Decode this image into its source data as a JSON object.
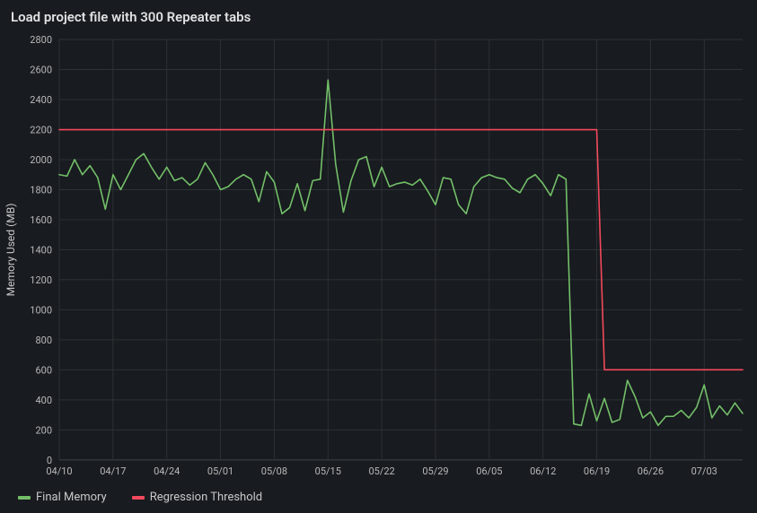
{
  "title": "Load project file with 300 Repeater tabs",
  "ylabel": "Memory Used (MB)",
  "legend": {
    "final_memory": "Final Memory",
    "regression_threshold": "Regression Threshold"
  },
  "colors": {
    "final_memory": "#73bf69",
    "regression_threshold": "#f2495c",
    "grid": "#2c3235",
    "axis_text": "#b7b8b9"
  },
  "chart_data": {
    "type": "line",
    "xlabel": "",
    "ylabel": "Memory Used (MB)",
    "ylim": [
      0,
      2800
    ],
    "x_ticks": [
      "04/10",
      "04/17",
      "04/24",
      "05/01",
      "05/08",
      "05/15",
      "05/22",
      "05/29",
      "06/05",
      "06/12",
      "06/19",
      "06/26",
      "07/03"
    ],
    "y_ticks": [
      0,
      200,
      400,
      600,
      800,
      1000,
      1200,
      1400,
      1600,
      1800,
      2000,
      2200,
      2400,
      2600,
      2800
    ],
    "x": [
      0,
      1,
      2,
      3,
      4,
      5,
      6,
      7,
      8,
      9,
      10,
      11,
      12,
      13,
      14,
      15,
      16,
      17,
      18,
      19,
      20,
      21,
      22,
      23,
      24,
      25,
      26,
      27,
      28,
      29,
      30,
      31,
      32,
      33,
      34,
      35,
      36,
      37,
      38,
      39,
      40,
      41,
      42,
      43,
      44,
      45,
      46,
      47,
      48,
      49,
      50,
      51,
      52,
      53,
      54,
      55,
      56,
      57,
      58,
      59,
      60,
      61,
      62,
      63,
      64,
      65,
      66,
      67,
      68,
      69,
      70,
      71,
      72,
      73,
      74,
      75,
      76,
      77,
      78,
      79,
      80,
      81,
      82,
      83,
      84,
      85,
      86,
      87,
      88,
      89
    ],
    "series": [
      {
        "name": "Final Memory",
        "color": "#73bf69",
        "values": [
          1900,
          1890,
          2000,
          1900,
          1960,
          1880,
          1670,
          1900,
          1800,
          1900,
          2000,
          2040,
          1950,
          1870,
          1950,
          1860,
          1880,
          1830,
          1870,
          1980,
          1900,
          1800,
          1820,
          1870,
          1900,
          1870,
          1720,
          1920,
          1850,
          1640,
          1680,
          1840,
          1660,
          1860,
          1870,
          2530,
          1970,
          1650,
          1860,
          2000,
          2020,
          1820,
          1950,
          1820,
          1840,
          1850,
          1830,
          1870,
          1790,
          1700,
          1880,
          1870,
          1700,
          1640,
          1820,
          1880,
          1900,
          1880,
          1870,
          1810,
          1780,
          1870,
          1900,
          1840,
          1760,
          1900,
          1870,
          240,
          230,
          440,
          260,
          410,
          250,
          270,
          530,
          420,
          280,
          320,
          230,
          290,
          290,
          330,
          280,
          350,
          500,
          280,
          360,
          300,
          380,
          310
        ]
      },
      {
        "name": "Regression Threshold",
        "color": "#f2495c",
        "values": [
          2200,
          2200,
          2200,
          2200,
          2200,
          2200,
          2200,
          2200,
          2200,
          2200,
          2200,
          2200,
          2200,
          2200,
          2200,
          2200,
          2200,
          2200,
          2200,
          2200,
          2200,
          2200,
          2200,
          2200,
          2200,
          2200,
          2200,
          2200,
          2200,
          2200,
          2200,
          2200,
          2200,
          2200,
          2200,
          2200,
          2200,
          2200,
          2200,
          2200,
          2200,
          2200,
          2200,
          2200,
          2200,
          2200,
          2200,
          2200,
          2200,
          2200,
          2200,
          2200,
          2200,
          2200,
          2200,
          2200,
          2200,
          2200,
          2200,
          2200,
          2200,
          2200,
          2200,
          2200,
          2200,
          2200,
          2200,
          2200,
          2200,
          2200,
          2200,
          600,
          600,
          600,
          600,
          600,
          600,
          600,
          600,
          600,
          600,
          600,
          600,
          600,
          600,
          600,
          600,
          600,
          600,
          600
        ]
      }
    ]
  }
}
